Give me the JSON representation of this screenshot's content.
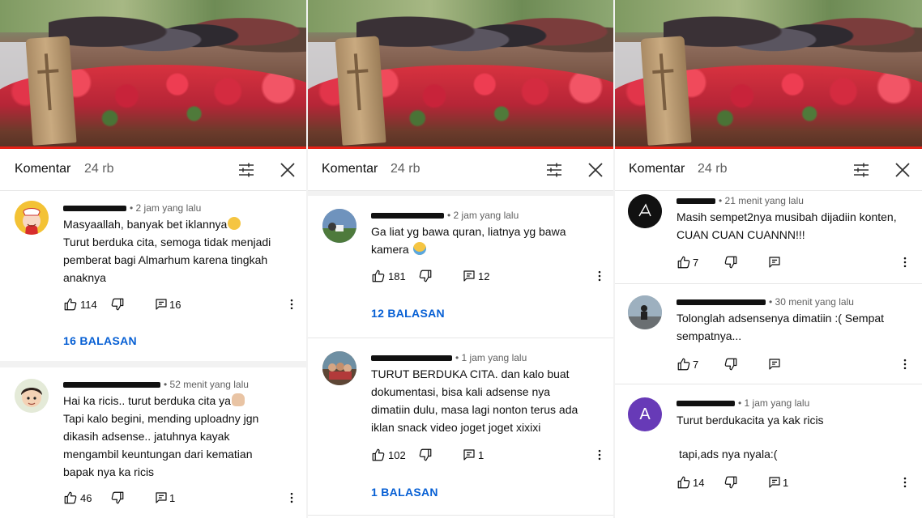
{
  "colors": {
    "link_blue": "#065fd4",
    "secondary_text": "#606060",
    "progress_red": "#e62117"
  },
  "panels": [
    {
      "header": {
        "title": "Komentar",
        "count": "24 rb"
      },
      "comments": [
        {
          "avatar": "chef-cartoon-avatar",
          "meta": "• 2 jam yang lalu",
          "lines": [
            "Masyaallah, banyak bet iklannya",
            "Turut berduka cita, semoga tidak menjadi",
            "pemberat bagi Almarhum karena tingkah",
            "anaknya"
          ],
          "likes": "114",
          "replies_count": "16",
          "replies_label": "16 BALASAN"
        },
        {
          "avatar": "boy-cartoon-avatar",
          "meta": "• 52 menit yang lalu",
          "lines": [
            "Hai ka ricis.. turut berduka cita ya",
            "Tapi kalo begini, mending uploadny jgn",
            "dikasih adsense.. jatuhnya kayak",
            "mengambil keuntungan dari kematian",
            "bapak nya ka ricis"
          ],
          "likes": "46",
          "replies_count": "1"
        }
      ]
    },
    {
      "header": {
        "title": "Komentar",
        "count": "24 rb"
      },
      "comments": [
        {
          "avatar": "outdoor-photo-avatar",
          "meta": "• 2 jam yang lalu",
          "lines": [
            "Ga liat yg bawa quran, liatnya yg bawa",
            "kamera"
          ],
          "likes": "181",
          "replies_count": "12",
          "replies_label": "12 BALASAN"
        },
        {
          "avatar": "group-photo-avatar",
          "meta": "• 1 jam yang lalu",
          "lines": [
            "TURUT BERDUKA CITA. dan kalo buat",
            "dokumentasi, bisa kali adsense nya",
            "dimatiin dulu, masa lagi nonton terus ada",
            "iklan snack video joget joget xixixi"
          ],
          "likes": "102",
          "replies_count": "1",
          "replies_label": "1 BALASAN"
        }
      ]
    },
    {
      "header": {
        "title": "Komentar",
        "count": "24 rb"
      },
      "comments": [
        {
          "avatar": "black-logo-avatar",
          "meta": "• 21 menit yang lalu",
          "lines": [
            "Masih sempet2nya musibah dijadiin konten,",
            "CUAN CUAN CUANNN!!!"
          ],
          "likes": "7"
        },
        {
          "avatar": "beach-photo-avatar",
          "meta": "• 30 menit yang lalu",
          "lines": [
            "Tolonglah adsensenya dimatiin :( Sempat",
            "sempatnya..."
          ],
          "likes": "7"
        },
        {
          "avatar": "letter-a-avatar",
          "avatar_letter": "A",
          "meta": "• 1 jam yang lalu",
          "lines": [
            "Turut berdukacita ya kak ricis",
            "",
            "tapi,ads nya nyala:("
          ],
          "likes": "14",
          "replies_count": "1"
        }
      ]
    }
  ]
}
